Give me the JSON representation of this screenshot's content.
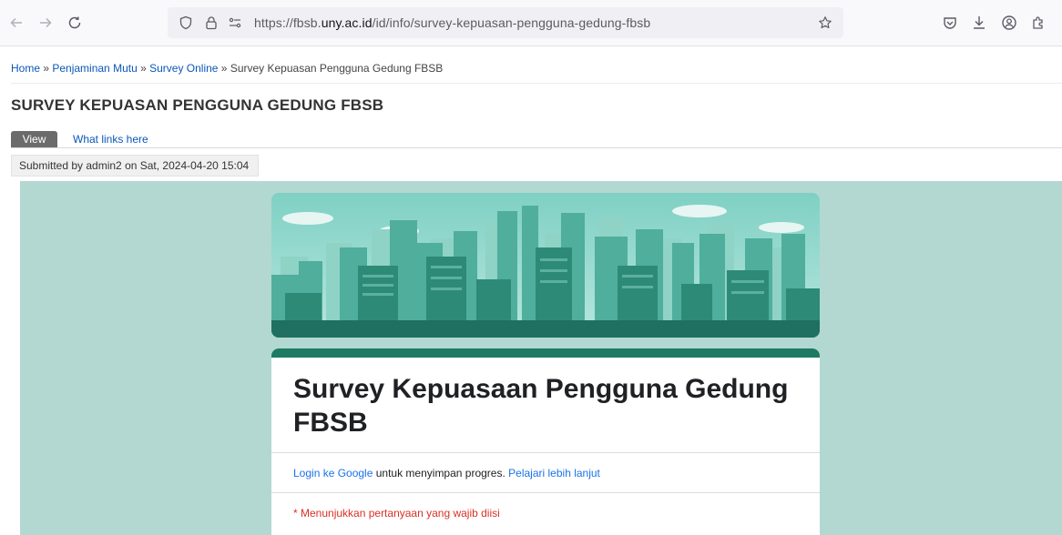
{
  "browser": {
    "url_prefix": "https://fbsb.",
    "url_domain": "uny.ac.id",
    "url_path": "/id/info/survey-kepuasan-pengguna-gedung-fbsb",
    "icons": {
      "back": "back-arrow-icon",
      "forward": "forward-arrow-icon",
      "reload": "reload-icon",
      "shield": "shield-icon",
      "lock": "lock-icon",
      "permissions": "permissions-icon",
      "bookmark": "star-icon",
      "pocket": "pocket-icon",
      "download": "download-icon",
      "account": "account-icon",
      "extensions": "extensions-icon"
    }
  },
  "breadcrumb": {
    "home": "Home",
    "sep": " » ",
    "item2": "Penjaminan Mutu",
    "item3": "Survey Online",
    "current": "Survey Kepuasan Pengguna Gedung FBSB"
  },
  "page": {
    "title": "SURVEY KEPUASAN PENGGUNA GEDUNG FBSB",
    "tabs": [
      {
        "label": "View"
      },
      {
        "label": "What links here"
      }
    ],
    "submitted": "Submitted by admin2 on Sat, 2024-04-20 15:04"
  },
  "form": {
    "title": "Survey Kepuasaan Pengguna Gedung FBSB",
    "login_link": "Login ke Google",
    "login_text": " untuk menyimpan progres. ",
    "learn_more": "Pelajari lebih lanjut",
    "required_note": "* Menunjukkan pertanyaan yang wajib diisi"
  },
  "colors": {
    "link": "#0a57b8",
    "embed_bg": "#b2d8d1",
    "form_accent": "#1e7a63",
    "required": "#d93025"
  }
}
